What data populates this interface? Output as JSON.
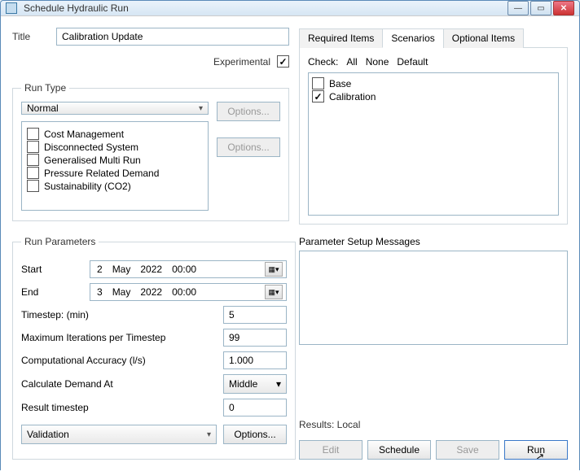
{
  "window": {
    "title": "Schedule Hydraulic Run",
    "min_btn": "—",
    "max_btn": "▭",
    "close_btn": "✕"
  },
  "title_label": "Title",
  "title_value": "Calibration Update",
  "experimental_label": "Experimental",
  "run_type": {
    "legend": "Run Type",
    "selected": "Normal",
    "options_btn": "Options...",
    "list": [
      "Cost Management",
      "Disconnected System",
      "Generalised Multi Run",
      "Pressure Related Demand",
      "Sustainability (CO2)"
    ]
  },
  "run_params": {
    "legend": "Run Parameters",
    "start_label": "Start",
    "end_label": "End",
    "start": {
      "day": "2",
      "month": "May",
      "year": "2022",
      "time": "00:00"
    },
    "end": {
      "day": "3",
      "month": "May",
      "year": "2022",
      "time": "00:00"
    },
    "timestep_label": "Timestep: (min)",
    "timestep_value": "5",
    "maxiter_label": "Maximum Iterations per Timestep",
    "maxiter_value": "99",
    "accuracy_label": "Computational Accuracy (l/s)",
    "accuracy_value": "1.000",
    "demand_label": "Calculate Demand At",
    "demand_value": "Middle",
    "result_ts_label": "Result timestep",
    "result_ts_value": "0",
    "validation_value": "Validation",
    "options_btn": "Options..."
  },
  "tabs": {
    "required": "Required Items",
    "scenarios": "Scenarios",
    "optional": "Optional Items"
  },
  "scenarios": {
    "check_label": "Check:",
    "all": "All",
    "none": "None",
    "default": "Default",
    "items": [
      {
        "label": "Base",
        "checked": false
      },
      {
        "label": "Calibration",
        "checked": true
      }
    ]
  },
  "msg_label": "Parameter Setup Messages",
  "results_label": "Results: Local",
  "buttons": {
    "edit": "Edit",
    "schedule": "Schedule",
    "save": "Save",
    "run": "Run"
  }
}
